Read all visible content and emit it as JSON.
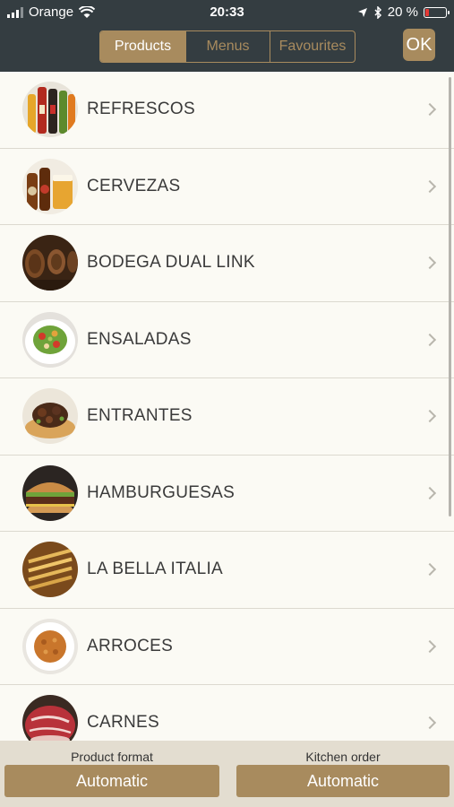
{
  "status": {
    "carrier": "Orange",
    "time": "20:33",
    "battery": "20 %"
  },
  "nav": {
    "tabs": [
      "Products",
      "Menus",
      "Favourites"
    ],
    "ok_label": "OK"
  },
  "categories": [
    {
      "label": "REFRESCOS",
      "image": "soft-drink-bottles-thumbnail"
    },
    {
      "label": "CERVEZAS",
      "image": "beer-bottles-thumbnail"
    },
    {
      "label": "BODEGA DUAL LINK",
      "image": "wine-cellar-thumbnail"
    },
    {
      "label": "ENSALADAS",
      "image": "salad-plate-thumbnail"
    },
    {
      "label": "ENTRANTES",
      "image": "starter-dish-thumbnail"
    },
    {
      "label": "HAMBURGUESAS",
      "image": "hamburger-thumbnail"
    },
    {
      "label": "LA BELLA ITALIA",
      "image": "pasta-thumbnail"
    },
    {
      "label": "ARROCES",
      "image": "rice-dish-thumbnail"
    },
    {
      "label": "CARNES",
      "image": "meat-steak-thumbnail"
    }
  ],
  "bottom": {
    "product_format_label": "Product format",
    "product_format_value": "Automatic",
    "kitchen_order_label": "Kitchen order",
    "kitchen_order_value": "Automatic"
  }
}
